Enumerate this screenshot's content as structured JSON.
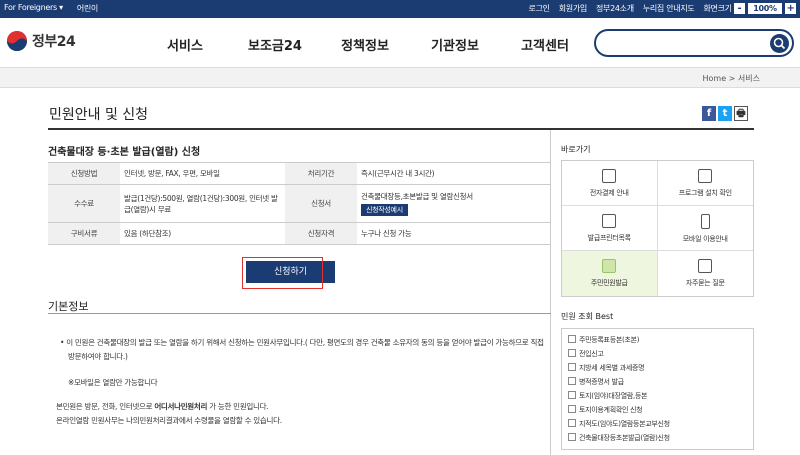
{
  "topbar": {
    "foreigners": "For Foreigners ▾",
    "kids": "어린이",
    "login": "로그인",
    "join": "회원가입",
    "intro": "정부24소개",
    "sitemap": "누리집 안내지도",
    "zoom_label": "화면크기",
    "zoom_minus": "-",
    "zoom_value": "100%",
    "zoom_plus": "+"
  },
  "header": {
    "logo_text": "정부24",
    "nav": [
      "서비스",
      "보조금24",
      "정책정보",
      "기관정보",
      "고객센터"
    ]
  },
  "breadcrumb": "Home  >  서비스",
  "page_title": "민원안내 및 신청",
  "share": [
    "f",
    "t",
    "🖶"
  ],
  "service": {
    "title": "건축물대장 등·초본 발급(열람) 신청",
    "rows": [
      {
        "h1": "신청방법",
        "v1": "인터넷, 방문, FAX, 우편, 모바일",
        "h2": "처리기간",
        "v2": "즉시(근무시간 내 3시간)"
      },
      {
        "h1": "수수료",
        "v1": "발급(1건당):500원, 열람(1건당):300원, 인터넷 발급(열람)시 무료",
        "h2": "신청서",
        "v2": "건축물대장등,초본발급 및 열람신청서"
      },
      {
        "h1": "구비서류",
        "v1": "있음 (하단참조)",
        "h2": "신청자격",
        "v2": "누구나 신청 가능"
      }
    ],
    "form_button": "신청작성예시",
    "apply_button": "신청하기"
  },
  "basic": {
    "title": "기본정보",
    "bullet": "이 민원은 건축물대장의 발급 또는 열람을 하기 위해서 신청하는 민원사무입니다.( 다만, 평면도의 경우 건축물 소유자의 동의 등을 얻어야 발급이 가능하므로 직접 방문하여야 합니다.)",
    "note": "※모바일은 열람만 가능합니다",
    "line1a": "본민원은 방문, 전화, 인터넷으로 ",
    "line1b": "어디서나민원처리",
    "line1c": " 가 능한 민원입니다.",
    "line2": "온라인열람 민원사무는 나의민원처리결과에서 수령물을 열람할 수 있습니다."
  },
  "side": {
    "quick_title": "바로가기",
    "quick": [
      "전자결제 안내",
      "프로그램 설치 확인",
      "발급프린터목록",
      "모바일 이용안내",
      "주민민원발급",
      "자주묻는 질문"
    ],
    "best_title": "민원 조회 Best",
    "best": [
      "주민등록표등본(초본)",
      "전입신고",
      "지방세 세목별 과세증명",
      "병적증명서 발급",
      "토지(임야)대장열람,등본",
      "토지이용계획확인 신청",
      "지적도(임야도)열람등본교부신청",
      "건축물대장등초본발급(열람)신청"
    ]
  },
  "colors": {
    "primary": "#1b3b73",
    "highlight": "#e03030"
  }
}
